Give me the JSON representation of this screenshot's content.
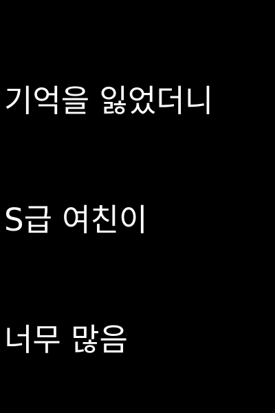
{
  "colors": {
    "background": "#000000",
    "text": "#ffffff"
  },
  "lines": [
    "기억을 잃었더니",
    "S급 여친이",
    "너무 많음"
  ]
}
